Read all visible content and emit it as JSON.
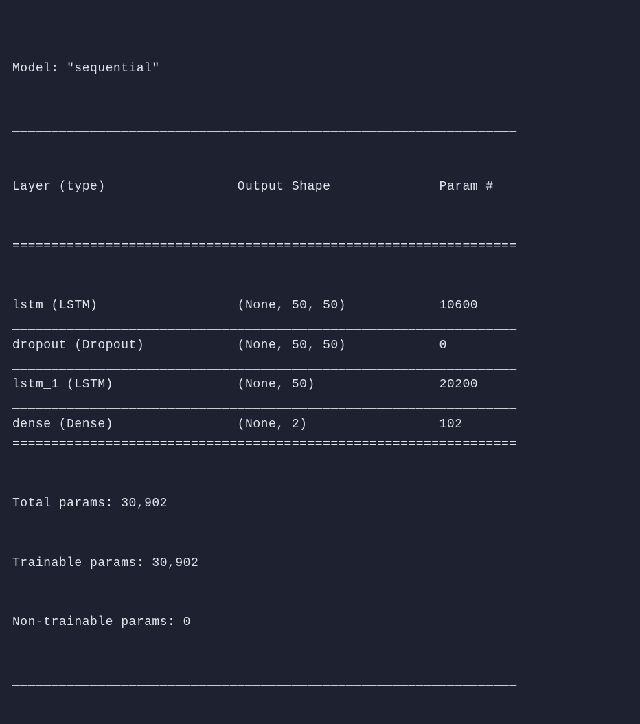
{
  "chart_data": {
    "type": "table",
    "title": "Model: \"sequential\"",
    "columns": [
      "Layer (type)",
      "Output Shape",
      "Param #"
    ],
    "rows": [
      [
        "lstm (LSTM)",
        "(None, 50, 50)",
        "10600"
      ],
      [
        "dropout (Dropout)",
        "(None, 50, 50)",
        "0"
      ],
      [
        "lstm_1 (LSTM)",
        "(None, 50)",
        "20200"
      ],
      [
        "dense (Dense)",
        "(None, 2)",
        "102"
      ]
    ],
    "footer": [
      "Total params: 30,902",
      "Trainable params: 30,902",
      "Non-trainable params: 0"
    ]
  },
  "summary": {
    "model_line": "Model: \"sequential\"",
    "single_dash": "_________________________________________________________________",
    "double_dash": "=================================================================",
    "header": {
      "col1": "Layer (type)",
      "col2": "Output Shape",
      "col3": "Param #"
    },
    "layers": [
      {
        "name": "lstm (LSTM)",
        "shape": "(None, 50, 50)",
        "params": "10600"
      },
      {
        "name": "dropout (Dropout)",
        "shape": "(None, 50, 50)",
        "params": "0"
      },
      {
        "name": "lstm_1 (LSTM)",
        "shape": "(None, 50)",
        "params": "20200"
      },
      {
        "name": "dense (Dense)",
        "shape": "(None, 2)",
        "params": "102"
      }
    ],
    "totals": {
      "total": "Total params: 30,902",
      "trainable": "Trainable params: 30,902",
      "nontrainable": "Non-trainable params: 0"
    },
    "col_widths": {
      "c1": 29,
      "c2": 26
    }
  }
}
